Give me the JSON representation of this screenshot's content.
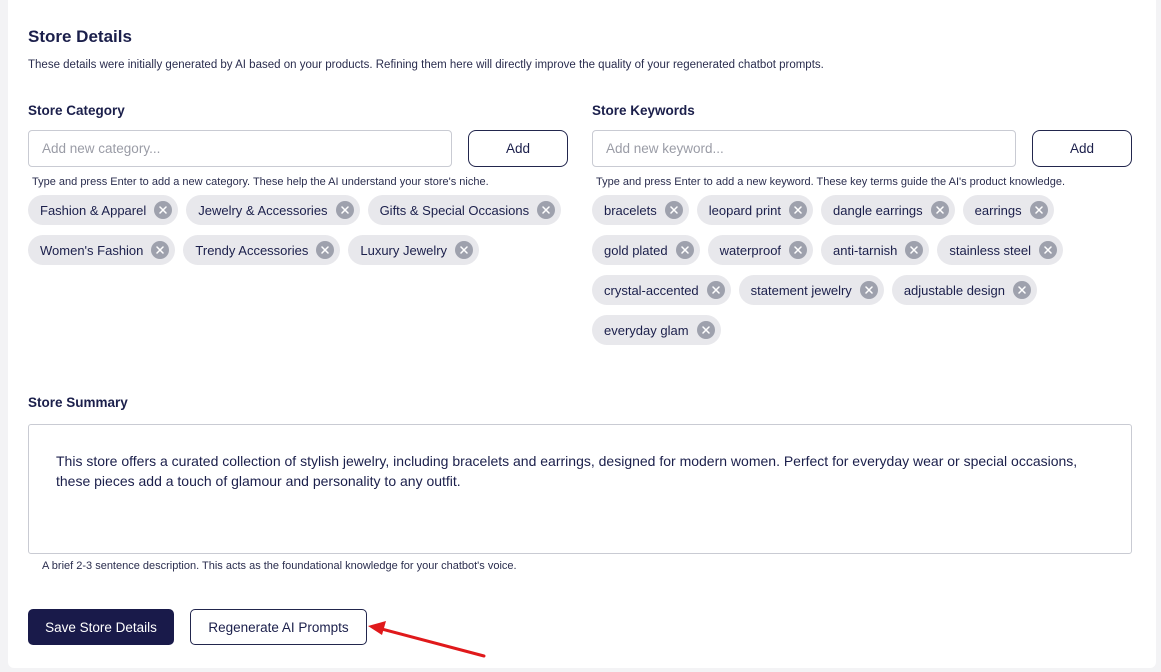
{
  "header": {
    "title": "Store Details",
    "subtitle": "These details were initially generated by AI based on your products. Refining them here will directly improve the quality of your regenerated chatbot prompts."
  },
  "category": {
    "label": "Store Category",
    "placeholder": "Add new category...",
    "add_label": "Add",
    "hint": "Type and press Enter to add a new category. These help the AI understand your store's niche.",
    "tags": [
      "Fashion & Apparel",
      "Jewelry & Accessories",
      "Gifts & Special Occasions",
      "Women's Fashion",
      "Trendy Accessories",
      "Luxury Jewelry"
    ]
  },
  "keywords": {
    "label": "Store Keywords",
    "placeholder": "Add new keyword...",
    "add_label": "Add",
    "hint": "Type and press Enter to add a new keyword. These key terms guide the AI's product knowledge.",
    "tags": [
      "bracelets",
      "leopard print",
      "dangle earrings",
      "earrings",
      "gold plated",
      "waterproof",
      "anti-tarnish",
      "stainless steel",
      "crystal-accented",
      "statement jewelry",
      "adjustable design",
      "everyday glam"
    ]
  },
  "summary": {
    "label": "Store Summary",
    "text": "This store offers a curated collection of stylish jewelry, including bracelets and earrings, designed for modern women. Perfect for everyday wear or special occasions, these pieces add a touch of glamour and personality to any outfit.",
    "hint": "A brief 2-3 sentence description. This acts as the foundational knowledge for your chatbot's voice."
  },
  "actions": {
    "save_label": "Save Store Details",
    "regenerate_label": "Regenerate AI Prompts"
  },
  "colors": {
    "primary": "#191a4a",
    "tag_bg": "#e8e8ec",
    "annotation_arrow": "#e0191b"
  },
  "icons": {
    "tag_remove": "close-circle-icon",
    "annotation": "red-arrow-icon"
  }
}
